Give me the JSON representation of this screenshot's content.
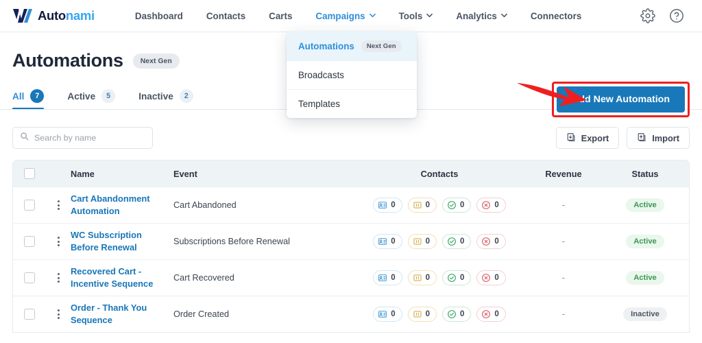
{
  "brand": {
    "name_part1": "Auto",
    "name_part2": "nami",
    "logo_icon": "autonami-v-logo"
  },
  "navbar": {
    "links": [
      {
        "label": "Dashboard",
        "has_chevron": false,
        "active": false
      },
      {
        "label": "Contacts",
        "has_chevron": false,
        "active": false
      },
      {
        "label": "Carts",
        "has_chevron": false,
        "active": false
      },
      {
        "label": "Campaigns",
        "has_chevron": true,
        "active": true
      },
      {
        "label": "Tools",
        "has_chevron": true,
        "active": false
      },
      {
        "label": "Analytics",
        "has_chevron": true,
        "active": false
      },
      {
        "label": "Connectors",
        "has_chevron": false,
        "active": false
      }
    ],
    "icons": [
      {
        "name": "gear-icon"
      },
      {
        "name": "help-circle-icon"
      }
    ]
  },
  "dropdown": {
    "items": [
      {
        "label": "Automations",
        "badge": "Next Gen",
        "active": true
      },
      {
        "label": "Broadcasts",
        "badge": "",
        "active": false
      },
      {
        "label": "Templates",
        "badge": "",
        "active": false
      }
    ]
  },
  "header": {
    "title": "Automations",
    "title_badge": "Next Gen",
    "tabs": [
      {
        "label": "All",
        "count": "7",
        "active": true
      },
      {
        "label": "Active",
        "count": "5",
        "active": false
      },
      {
        "label": "Inactive",
        "count": "2",
        "active": false
      }
    ],
    "cta_label": "Add New Automation"
  },
  "toolbar": {
    "search_placeholder": "Search by name",
    "search_value": "",
    "export_label": "Export",
    "import_label": "Import"
  },
  "table": {
    "columns": [
      "Name",
      "Event",
      "Contacts",
      "Revenue",
      "Status"
    ],
    "rows": [
      {
        "name": "Cart Abandonment Automation",
        "event": "Cart Abandoned",
        "contacts": [
          {
            "type": "queued",
            "value": "0"
          },
          {
            "type": "paused",
            "value": "0"
          },
          {
            "type": "completed",
            "value": "0"
          },
          {
            "type": "failed",
            "value": "0"
          }
        ],
        "revenue": "-",
        "status": "Active"
      },
      {
        "name": "WC Subscription Before Renewal",
        "event": "Subscriptions Before Renewal",
        "contacts": [
          {
            "type": "queued",
            "value": "0"
          },
          {
            "type": "paused",
            "value": "0"
          },
          {
            "type": "completed",
            "value": "0"
          },
          {
            "type": "failed",
            "value": "0"
          }
        ],
        "revenue": "-",
        "status": "Active"
      },
      {
        "name": "Recovered Cart - Incentive Sequence",
        "event": "Cart Recovered",
        "contacts": [
          {
            "type": "queued",
            "value": "0"
          },
          {
            "type": "paused",
            "value": "0"
          },
          {
            "type": "completed",
            "value": "0"
          },
          {
            "type": "failed",
            "value": "0"
          }
        ],
        "revenue": "-",
        "status": "Active"
      },
      {
        "name": "Order - Thank You Sequence",
        "event": "Order Created",
        "contacts": [
          {
            "type": "queued",
            "value": "0"
          },
          {
            "type": "paused",
            "value": "0"
          },
          {
            "type": "completed",
            "value": "0"
          },
          {
            "type": "failed",
            "value": "0"
          }
        ],
        "revenue": "-",
        "status": "Inactive"
      }
    ]
  },
  "annotation": {
    "arrow_color": "#ef1f1f",
    "highlight_color": "#ef1f1f"
  },
  "colors": {
    "accent_blue": "#1878b9",
    "link_blue": "#1a76b8",
    "active_green": "#3f9656",
    "inactive_gray": "#4d5662"
  }
}
